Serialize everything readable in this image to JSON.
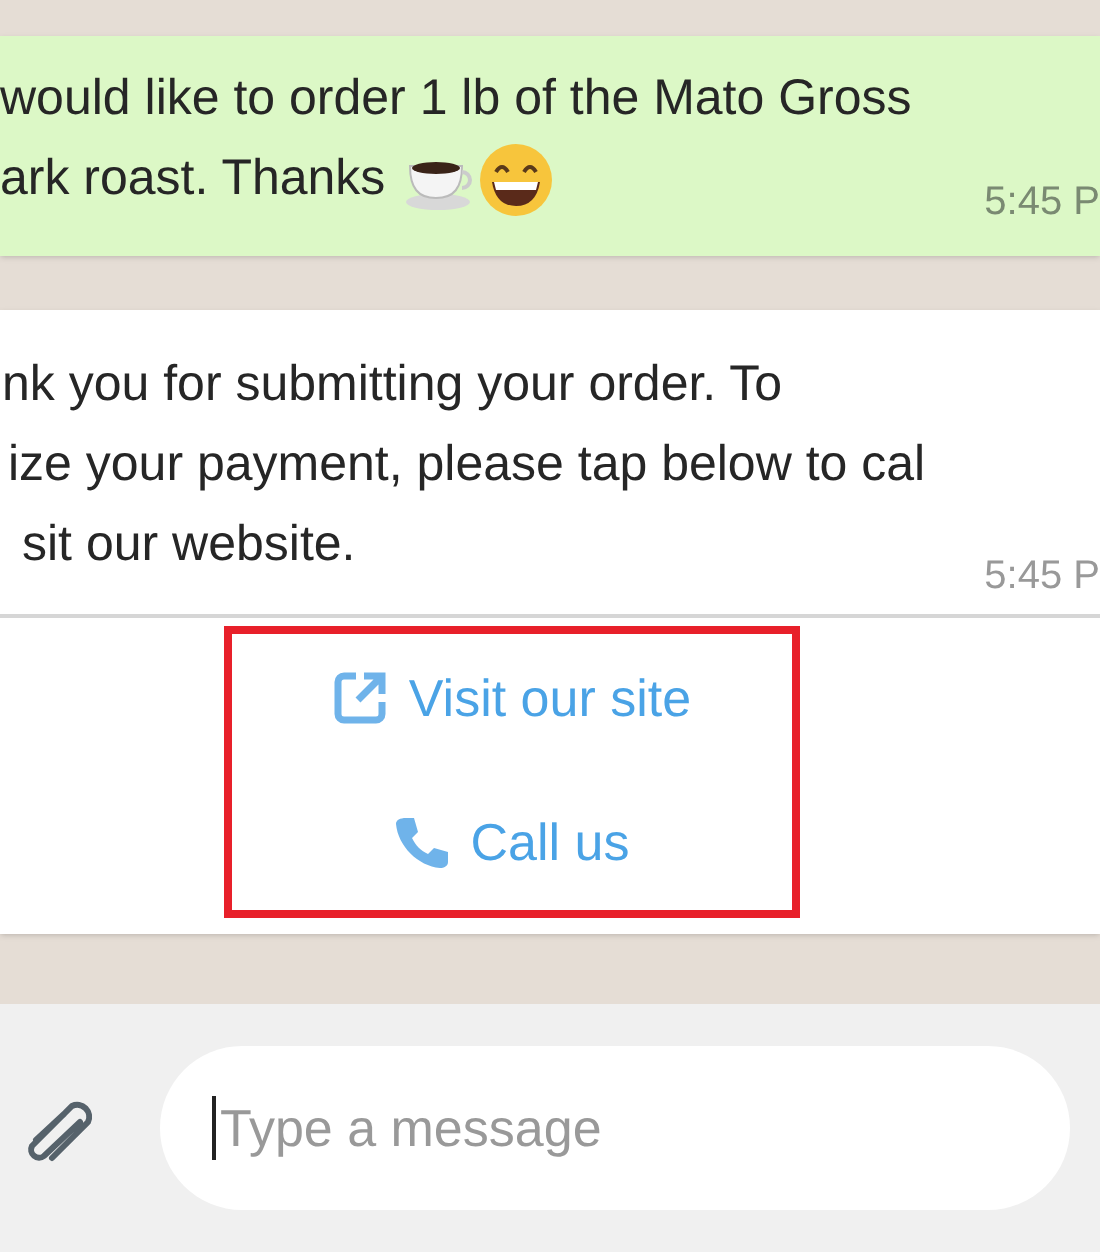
{
  "messages": [
    {
      "kind": "outgoing",
      "lines": [
        "would like to order 1 lb of the Mato Gross",
        "ark roast.  Thanks"
      ],
      "time": "5:45 P"
    },
    {
      "kind": "incoming",
      "lines": [
        "nk you for submitting your order. To",
        "ize your payment, please tap below to cal",
        "sit our website."
      ],
      "time": "5:45 P",
      "buttons": [
        {
          "kind": "link",
          "label": "Visit our site"
        },
        {
          "kind": "call",
          "label": "Call us"
        }
      ]
    }
  ],
  "composer": {
    "placeholder": "Type a message"
  }
}
